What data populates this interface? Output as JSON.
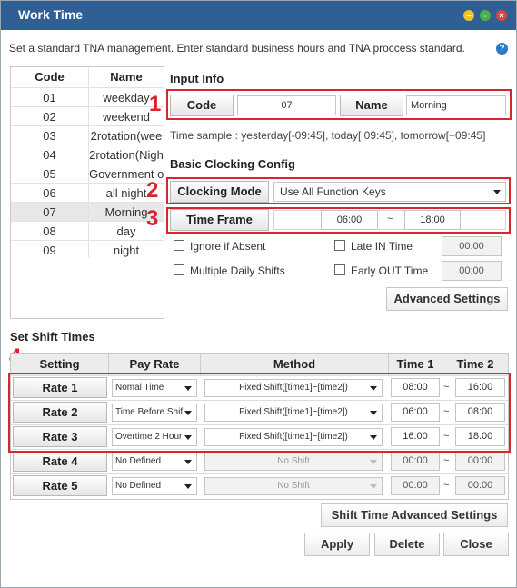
{
  "window": {
    "title": "Work Time",
    "min_icon": "minimize-icon",
    "max_icon": "maximize-icon",
    "close_icon": "close-icon"
  },
  "description": "Set a standard TNA management. Enter standard business hours and TNA proccess standard.",
  "help_icon": "?",
  "code_table": {
    "headers": [
      "Code",
      "Name"
    ],
    "rows": [
      {
        "code": "01",
        "name": "weekday"
      },
      {
        "code": "02",
        "name": "weekend"
      },
      {
        "code": "03",
        "name": "2rotation(wee"
      },
      {
        "code": "04",
        "name": "2rotation(Nigh"
      },
      {
        "code": "05",
        "name": "Government o"
      },
      {
        "code": "06",
        "name": "all night"
      },
      {
        "code": "07",
        "name": "Morning"
      },
      {
        "code": "08",
        "name": "day"
      },
      {
        "code": "09",
        "name": "night"
      }
    ],
    "selected_index": 6
  },
  "input_info": {
    "section_title": "Input Info",
    "code_label": "Code",
    "code_value": "07",
    "name_label": "Name",
    "name_value": "Morning",
    "time_sample": "Time sample : yesterday[-09:45], today[ 09:45], tomorrow[+09:45]"
  },
  "clocking": {
    "section_title": "Basic Clocking Config",
    "mode_label": "Clocking Mode",
    "mode_value": "Use All Function Keys",
    "timeframe_label": "Time Frame",
    "timeframe_start": "06:00",
    "timeframe_sep": "~",
    "timeframe_end": "18:00",
    "ignore_absent": "Ignore if Absent",
    "late_in": "Late IN Time",
    "late_in_value": "00:00",
    "multiple_shifts": "Multiple Daily Shifts",
    "early_out": "Early OUT Time",
    "early_out_value": "00:00",
    "advanced_button": "Advanced Settings"
  },
  "annotations": [
    "1",
    "2",
    "3",
    "4"
  ],
  "shift": {
    "section_title": "Set Shift Times",
    "headers": [
      "Setting",
      "Pay Rate",
      "Method",
      "Time 1",
      "Time 2"
    ],
    "rows": [
      {
        "setting": "Rate 1",
        "pay_rate": "Nomal Time",
        "method": "Fixed Shift([time1]~[time2])",
        "time1": "08:00",
        "sep": "~",
        "time2": "16:00",
        "enabled": true
      },
      {
        "setting": "Rate 2",
        "pay_rate": "Time Before Shif",
        "method": "Fixed Shift([time1]~[time2])",
        "time1": "06:00",
        "sep": "~",
        "time2": "08:00",
        "enabled": true
      },
      {
        "setting": "Rate 3",
        "pay_rate": "Overtime 2 Hour",
        "method": "Fixed Shift([time1]~[time2])",
        "time1": "16:00",
        "sep": "~",
        "time2": "18:00",
        "enabled": true
      },
      {
        "setting": "Rate 4",
        "pay_rate": "No Defined",
        "method": "No Shift",
        "time1": "00:00",
        "sep": "~",
        "time2": "00:00",
        "enabled": false
      },
      {
        "setting": "Rate 5",
        "pay_rate": "No Defined",
        "method": "No Shift",
        "time1": "00:00",
        "sep": "~",
        "time2": "00:00",
        "enabled": false
      }
    ],
    "advanced_button": "Shift Time Advanced Settings"
  },
  "footer": {
    "apply": "Apply",
    "delete": "Delete",
    "close": "Close"
  },
  "colors": {
    "titlebar": "#2f5f94",
    "annotation_red": "#d7262e",
    "help_blue": "#2b78c6"
  }
}
